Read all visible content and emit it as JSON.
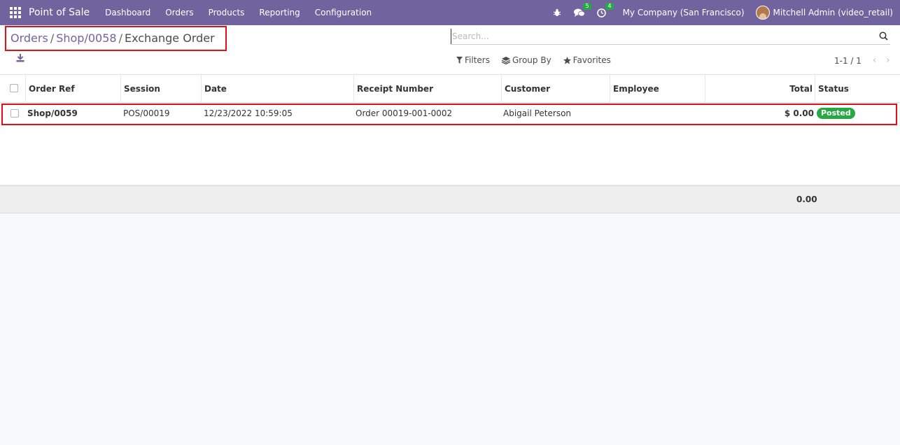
{
  "navbar": {
    "app_name": "Point of Sale",
    "menu": [
      "Dashboard",
      "Orders",
      "Products",
      "Reporting",
      "Configuration"
    ],
    "messages_count": "5",
    "activities_count": "4",
    "company": "My Company (San Francisco)",
    "user": "Mitchell Admin (video_retail)",
    "accent": "#71639e"
  },
  "breadcrumb": {
    "items": [
      "Orders",
      "Shop/0058"
    ],
    "current": "Exchange Order",
    "separator": "/"
  },
  "search": {
    "placeholder": "Search..."
  },
  "filters": {
    "filters_label": "Filters",
    "group_by_label": "Group By",
    "favorites_label": "Favorites"
  },
  "pager": {
    "value": "1-1 / 1"
  },
  "table": {
    "columns": {
      "order_ref": "Order Ref",
      "session": "Session",
      "date": "Date",
      "receipt": "Receipt Number",
      "customer": "Customer",
      "employee": "Employee",
      "total": "Total",
      "status": "Status"
    },
    "rows": [
      {
        "order_ref": "Shop/0059",
        "session": "POS/00019",
        "date": "12/23/2022 10:59:05",
        "receipt": "Order 00019-001-0002",
        "customer": "Abigail Peterson",
        "employee": "",
        "total": "$ 0.00",
        "status": "Posted"
      }
    ],
    "footer_total": "0.00",
    "status_color": "#28a745"
  }
}
